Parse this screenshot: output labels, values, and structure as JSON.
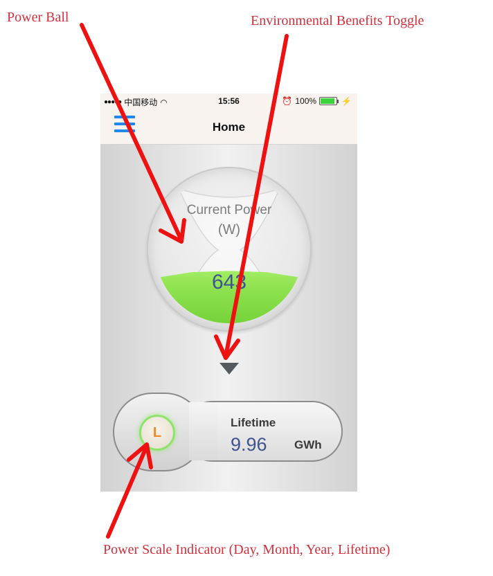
{
  "annotations": {
    "power_ball": "Power Ball",
    "environmental_toggle": "Environmental Benefits Toggle",
    "power_scale": "Power Scale Indicator (Day, Month, Year, Lifetime)",
    "color": "#d0303c"
  },
  "status_bar": {
    "carrier": "中国移动",
    "time": "15:56",
    "battery": "100%",
    "battery_level": 1.0
  },
  "nav": {
    "title": "Home",
    "menu_icon": "hamburger-menu-icon"
  },
  "power_ball": {
    "label": "Current Power",
    "unit": "(W)",
    "value": "643"
  },
  "env_toggle": {
    "icon": "triangle-down-icon"
  },
  "lifetime": {
    "scale_letter": "L",
    "label": "Lifetime",
    "value": "9.96",
    "unit": "GWh"
  },
  "colors": {
    "accent_blue": "#1f86f2",
    "value_blue": "#3e538f",
    "liquid_green": "#8fe24f",
    "scale_orange": "#f08a2b"
  }
}
